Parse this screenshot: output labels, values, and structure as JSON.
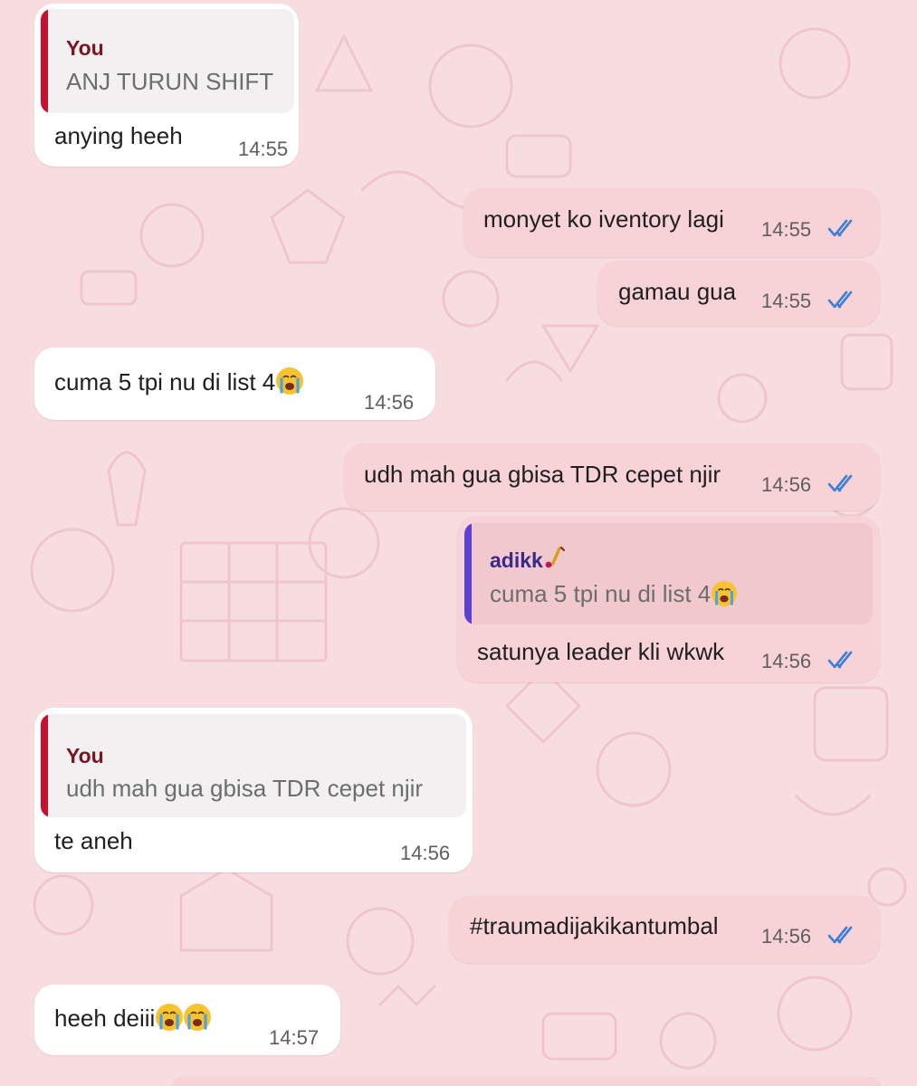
{
  "colors": {
    "wallpaper": "#f7dde0",
    "incoming_bubble": "#ffffff",
    "outgoing_bubble": "#f7d3d8",
    "quote_bar_you": "#c8102e",
    "quote_bar_contact": "#5b3fd6",
    "quote_author_you": "#7a1524",
    "quote_author_contact": "#3a2a8a",
    "read_ticks": "#3b7fd6"
  },
  "icons": {
    "read_receipt": "double-check-icon",
    "crying_emoji": "loudly-crying-face-emoji",
    "saxophone_emoji": "saxophone-emoji"
  },
  "messages": [
    {
      "direction": "incoming",
      "quote": {
        "author": "You",
        "text": "ANJ TURUN SHIFT"
      },
      "text": "anying heeh",
      "time": "14:55"
    },
    {
      "direction": "outgoing",
      "text": "monyet ko iventory lagi",
      "time": "14:55",
      "status": "read"
    },
    {
      "direction": "outgoing",
      "text": "gamau gua",
      "time": "14:55",
      "status": "read"
    },
    {
      "direction": "incoming",
      "text": "cuma 5 tpi nu di list 4",
      "time": "14:56"
    },
    {
      "direction": "outgoing",
      "text": "udh mah gua gbisa TDR cepet njir",
      "time": "14:56",
      "status": "read"
    },
    {
      "direction": "outgoing",
      "quote": {
        "author": "adikk",
        "text": "cuma 5 tpi nu di list 4"
      },
      "text": "satunya leader kli wkwk",
      "time": "14:56",
      "status": "read"
    },
    {
      "direction": "incoming",
      "quote": {
        "author": "You",
        "text": "udh mah gua gbisa TDR cepet njir"
      },
      "text": "te aneh",
      "time": "14:56"
    },
    {
      "direction": "outgoing",
      "text": "#traumadijakikantumbal",
      "time": "14:56",
      "status": "read"
    },
    {
      "direction": "incoming",
      "text": "heeh deiii",
      "time": "14:57"
    }
  ]
}
